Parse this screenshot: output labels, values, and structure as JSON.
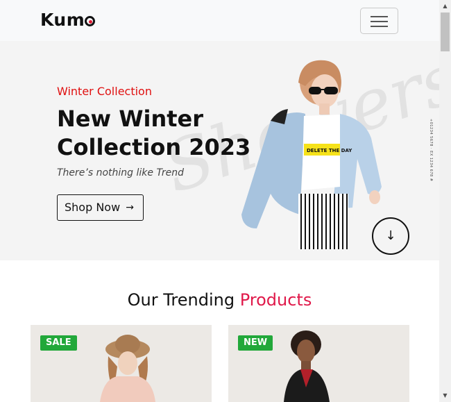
{
  "navbar": {
    "logo": "Kum",
    "logo_tail_icon": "circle-dot-icon",
    "menu_icon": "hamburger-icon"
  },
  "hero": {
    "subtitle": "Winter Collection",
    "title": "New Winter Collection 2023",
    "tagline": "There’s nothing like Trend",
    "button_label": "Shop Now",
    "button_icon": "→",
    "watermark": "Showers",
    "side_text": "+01234 5678 · EX 1234 678 #",
    "down_icon": "↓",
    "shirt_text": "DELETE THE DAY"
  },
  "trending": {
    "title_plain": "Our Trending",
    "title_accent": "Products",
    "cards": [
      {
        "badge": "SALE",
        "badge_color": "#22a83a"
      },
      {
        "badge": "NEW",
        "badge_color": "#22a83a"
      }
    ]
  },
  "colors": {
    "accent_red": "#e01010",
    "accent_pink": "#e0194a",
    "badge_green": "#22a83a"
  },
  "scrollbar": {
    "up_icon": "▲",
    "down_icon": "▼"
  }
}
